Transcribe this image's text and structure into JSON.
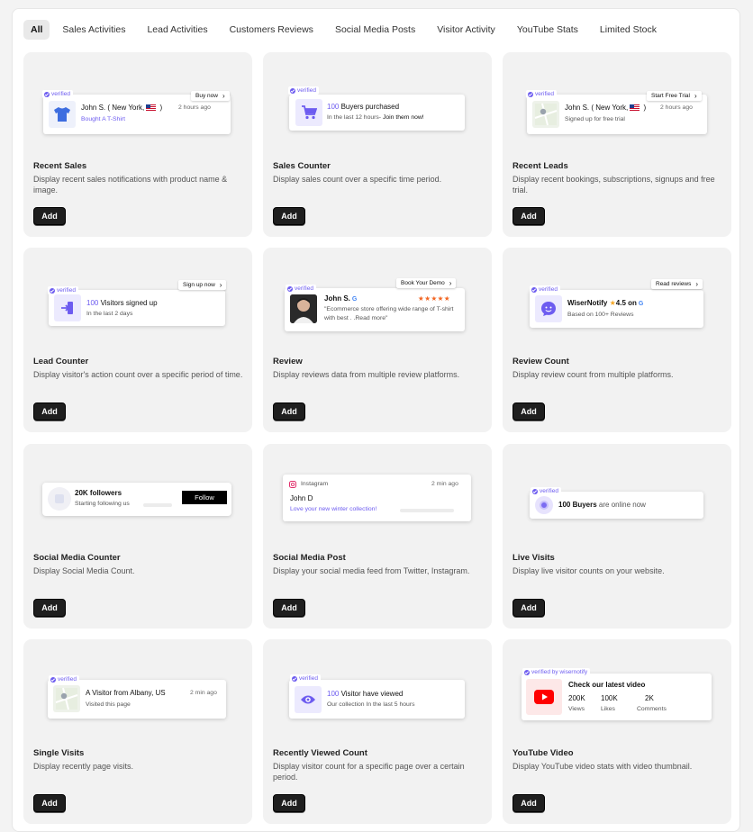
{
  "tabs": [
    "All",
    "Sales Activities",
    "Lead Activities",
    "Customers Reviews",
    "Social Media Posts",
    "Visitor Activity",
    "YouTube Stats",
    "Limited Stock"
  ],
  "add_label": "Add",
  "cards": [
    {
      "title": "Recent Sales",
      "desc": "Display recent sales notifications with product name & image.",
      "preview": {
        "badge": "verified",
        "cta": "Buy now",
        "name": "John S. ( New York,",
        "name_end": " )",
        "time": "2 hours ago",
        "sub_pre": "Bought ",
        "sub_accent": "A T-Shirt"
      }
    },
    {
      "title": "Sales Counter",
      "desc": "Display sales count over a specific time period.",
      "preview": {
        "badge": "verified",
        "count": "100",
        "main": " Buyers purchased",
        "sub": "In the last 12 hours- ",
        "sub_dark": "Join them now!"
      }
    },
    {
      "title": "Recent Leads",
      "desc": "Display recent bookings, subscriptions, signups and free trial.",
      "preview": {
        "badge": "verified",
        "cta": "Start Free Trial",
        "name": "John S. ( New York,",
        "name_end": " )",
        "time": "2 hours ago",
        "sub": "Signed up for free trial"
      }
    },
    {
      "title": "Lead Counter",
      "desc": "Display visitor's action count over a specific period of time.",
      "preview": {
        "badge": "verified",
        "cta": "Sign up now",
        "count": "100",
        "main": " Visitors signed up",
        "sub": "In the last 2 days"
      }
    },
    {
      "title": "Review",
      "desc": "Display reviews data from multiple review platforms.",
      "preview": {
        "badge": "verified",
        "cta": "Book Your Demo",
        "name": "John S.",
        "stars": "★★★★★",
        "text": "\"Ecommerce store offering wide range of T-shirt with best . .Read more\""
      }
    },
    {
      "title": "Review Count",
      "desc": "Display review count from multiple platforms.",
      "preview": {
        "badge": "verified",
        "cta": "Read reviews",
        "main": "WiserNotify",
        "rating": "4.5 on",
        "sub": "Based on 100+ Reviews"
      }
    },
    {
      "title": "Social Media Counter",
      "desc": "Display Social Media Count.",
      "preview": {
        "main": "20K followers",
        "sub": "Starting following us",
        "button": "Follow"
      }
    },
    {
      "title": "Social Media Post",
      "desc": "Display your social media feed from Twitter, Instagram.",
      "preview": {
        "platform": "Instagram",
        "time": "2 min ago",
        "name": "John D",
        "text": "Love your new winter collection!"
      }
    },
    {
      "title": "Live Visits",
      "desc": "Display live visitor counts on your website.",
      "preview": {
        "badge": "verified",
        "main": "100 Buyers",
        "main_rest": " are online now"
      }
    },
    {
      "title": "Single Visits",
      "desc": "Display recently page visits.",
      "preview": {
        "badge": "verified",
        "main": "A Visitor from Albany, US",
        "time": "2 min ago",
        "sub": "Visited this page"
      }
    },
    {
      "title": "Recently Viewed Count",
      "desc": "Display visitor count for a specific page over a certain period.",
      "preview": {
        "badge": "verified",
        "count": "100",
        "main": " Visitor have viewed",
        "sub": "Our collection In the last 5 hours"
      }
    },
    {
      "title": "YouTube Video",
      "desc": "Display YouTube video stats with video thumbnail.",
      "preview": {
        "badge": "verified by wisernotify",
        "main": "Check our latest video",
        "stats": [
          {
            "value": "200K",
            "label": "Views"
          },
          {
            "value": "100K",
            "label": "Likes"
          },
          {
            "value": "2K",
            "label": "Comments"
          }
        ]
      }
    }
  ],
  "colors": {
    "accent": "#6d5cf0",
    "star": "#f5a623",
    "youtube": "#ff0000",
    "card_bg": "#f2f2f2",
    "button": "#1f1f1f"
  }
}
